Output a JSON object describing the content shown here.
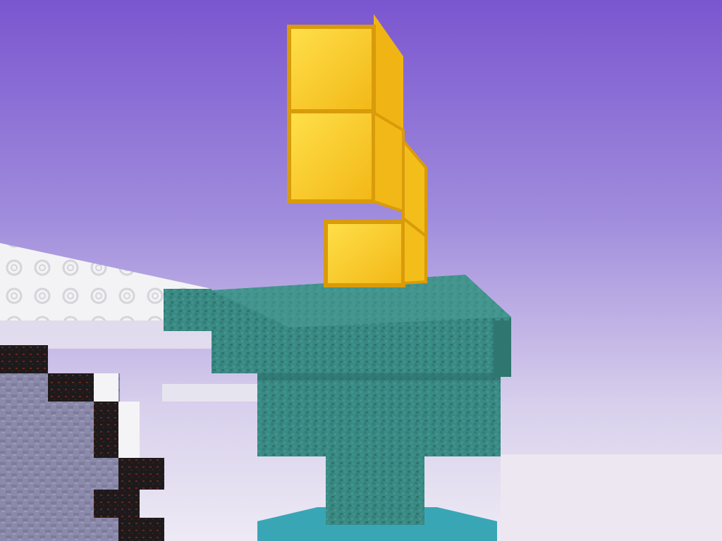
{
  "scene": {
    "sky": {
      "top_color": "#7A56CF",
      "mid_color": "#A08CDC",
      "horizon_color": "#D8D0EC",
      "ground_color": "#EEEAF4"
    },
    "blocks": {
      "gold_block": {
        "name": "gold-block",
        "color": "#F5C518",
        "highlight": "#FFE24A",
        "shadow": "#D89A0C"
      },
      "warped_block": {
        "name": "teal-stone-block",
        "color": "#3A8A84",
        "highlight": "#4FA19A",
        "shadow": "#2C6E69"
      },
      "quartz_block": {
        "name": "chiseled-quartz-block",
        "color": "#F2F2F2",
        "highlight": "#FFFFFF",
        "shadow": "#C9C9CC"
      },
      "blackstone_block": {
        "name": "gilded-blackstone-block",
        "color": "#1E1A1C",
        "accent": "#7A2A1E"
      },
      "stone_wall": {
        "name": "stone-brick-wall",
        "color": "#8A88A8",
        "shadow": "#6C6A8A"
      },
      "water": {
        "name": "water",
        "color": "#38A9B8"
      }
    }
  }
}
